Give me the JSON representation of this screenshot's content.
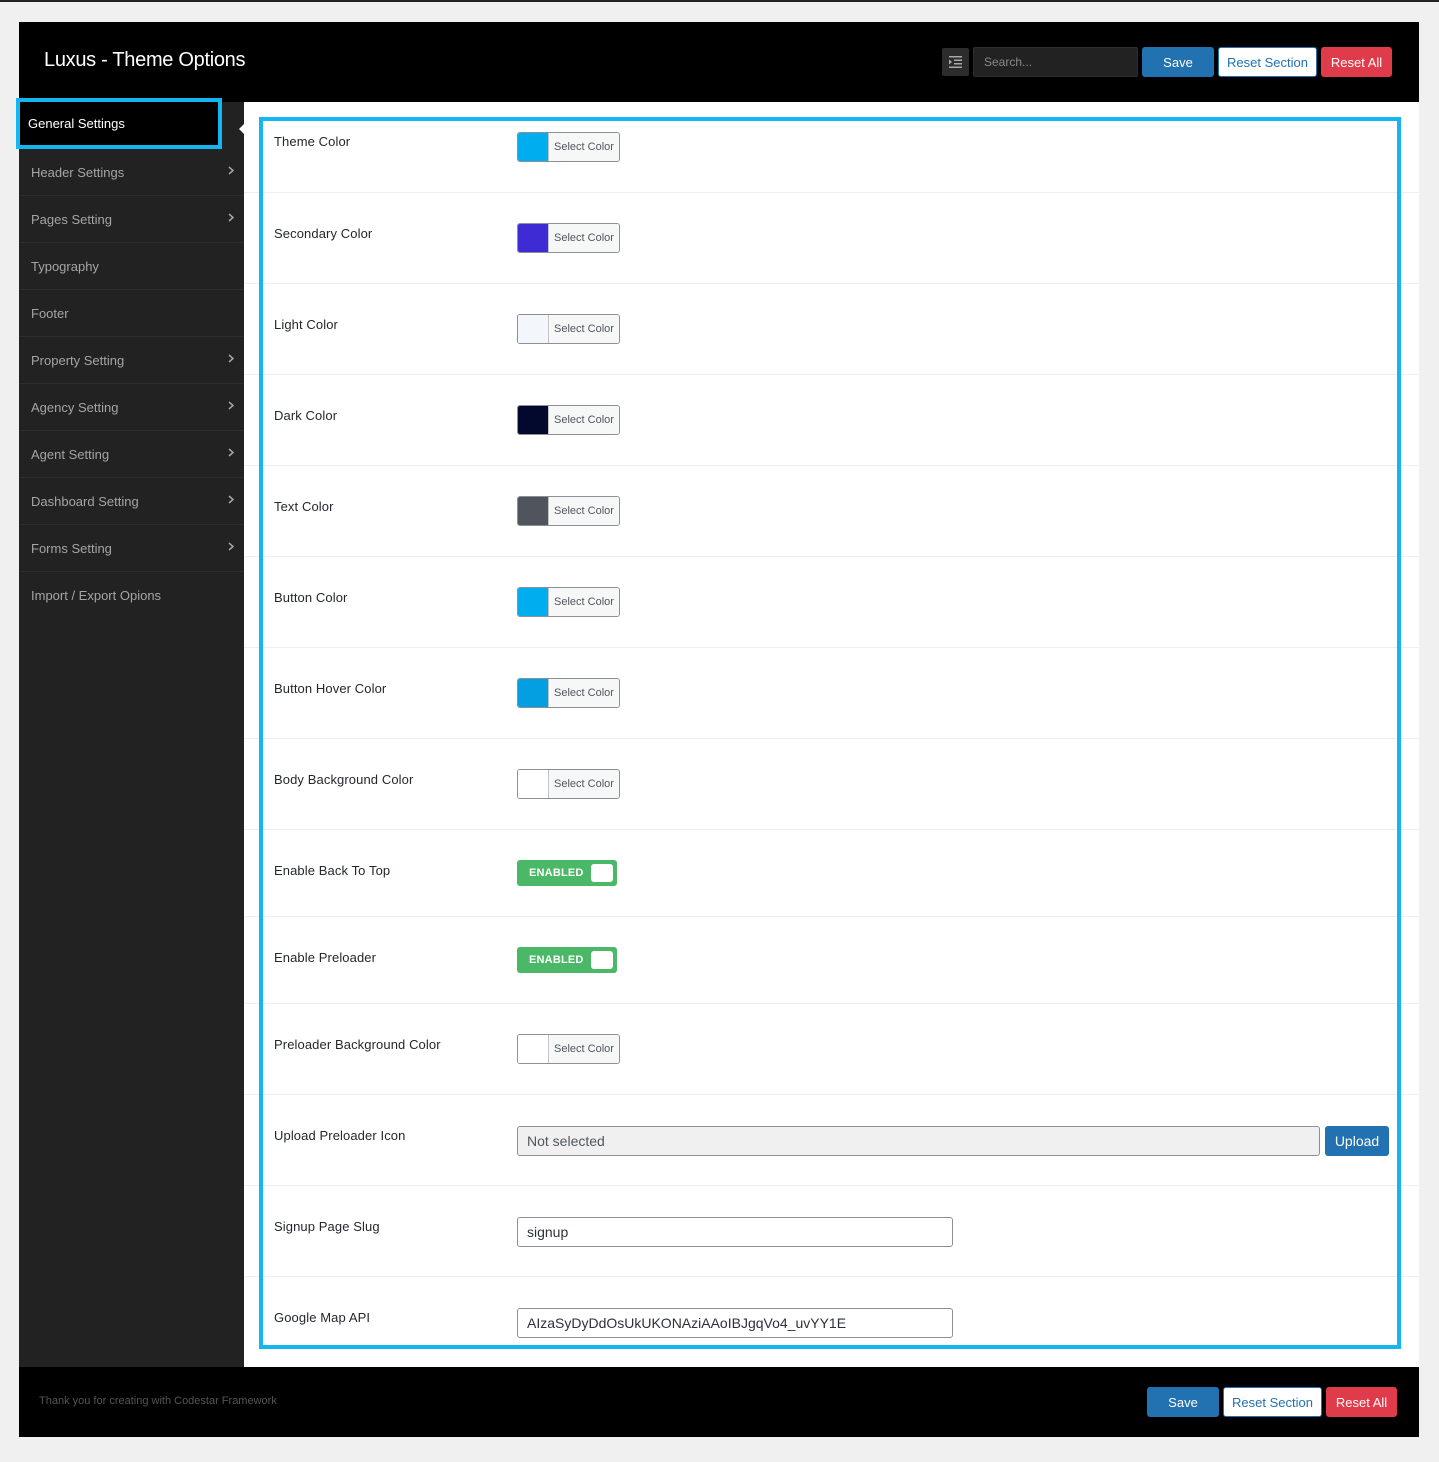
{
  "header": {
    "title": "Luxus - Theme Options",
    "search_placeholder": "Search...",
    "save_label": "Save",
    "reset_section_label": "Reset Section",
    "reset_all_label": "Reset All"
  },
  "sidebar": {
    "items": [
      {
        "label": "General Settings",
        "active": true,
        "has_children": false
      },
      {
        "label": "Header Settings",
        "has_children": true
      },
      {
        "label": "Pages Setting",
        "has_children": true
      },
      {
        "label": "Typography",
        "has_children": false
      },
      {
        "label": "Footer",
        "has_children": false
      },
      {
        "label": "Property Setting",
        "has_children": true
      },
      {
        "label": "Agency Setting",
        "has_children": true
      },
      {
        "label": "Agent Setting",
        "has_children": true
      },
      {
        "label": "Dashboard Setting",
        "has_children": true
      },
      {
        "label": "Forms Setting",
        "has_children": true
      },
      {
        "label": "Import / Export Opions",
        "has_children": false
      }
    ]
  },
  "fields": {
    "theme_color": {
      "label": "Theme Color",
      "button": "Select Color",
      "color": "#00aeef"
    },
    "secondary_color": {
      "label": "Secondary Color",
      "button": "Select Color",
      "color": "#3e2bd4"
    },
    "light_color": {
      "label": "Light Color",
      "button": "Select Color",
      "color": "#f3f7fc"
    },
    "dark_color": {
      "label": "Dark Color",
      "button": "Select Color",
      "color": "#02092c"
    },
    "text_color": {
      "label": "Text Color",
      "button": "Select Color",
      "color": "#50545d"
    },
    "button_color": {
      "label": "Button Color",
      "button": "Select Color",
      "color": "#00aeef"
    },
    "button_hover_color": {
      "label": "Button Hover Color",
      "button": "Select Color",
      "color": "#039fe0"
    },
    "body_background_color": {
      "label": "Body Background Color",
      "button": "Select Color",
      "color": "#ffffff"
    },
    "enable_back_to_top": {
      "label": "Enable Back To Top",
      "state": "ENABLED"
    },
    "enable_preloader": {
      "label": "Enable Preloader",
      "state": "ENABLED"
    },
    "preloader_background_color": {
      "label": "Preloader Background Color",
      "button": "Select Color",
      "color": "#ffffff"
    },
    "upload_preloader_icon": {
      "label": "Upload Preloader Icon",
      "value": "Not selected",
      "button": "Upload"
    },
    "signup_page_slug": {
      "label": "Signup Page Slug",
      "value": "signup"
    },
    "google_map_api": {
      "label": "Google Map API",
      "value": "AIzaSyDyDdOsUkUKONAziAAoIBJgqVo4_uvYY1E"
    }
  },
  "footer": {
    "credit": "Thank you for creating with Codestar Framework",
    "save_label": "Save",
    "reset_section_label": "Reset Section",
    "reset_all_label": "Reset All"
  },
  "colors": {
    "accent": "#14b6f2",
    "primary": "#2271b1",
    "danger": "#e03b4a",
    "enabled": "#4ab866"
  }
}
